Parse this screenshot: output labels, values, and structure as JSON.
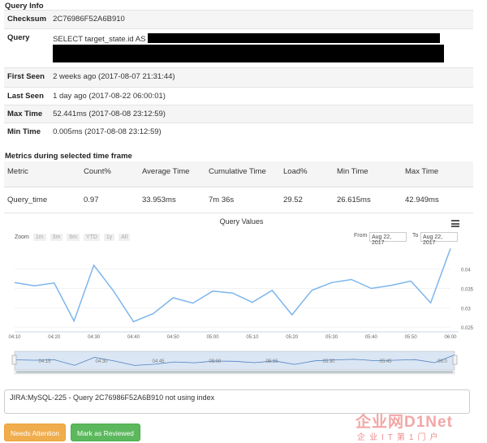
{
  "query_info": {
    "title": "Query Info",
    "checksum_label": "Checksum",
    "checksum": "2C76986F52A6B910",
    "query_label": "Query",
    "query_text": "SELECT target_state.id AS",
    "first_seen_label": "First Seen",
    "first_seen": "2 weeks ago (2017-08-07 21:31:44)",
    "last_seen_label": "Last Seen",
    "last_seen": "1 day ago (2017-08-22 06:00:01)",
    "max_time_label": "Max Time",
    "max_time": "52.441ms (2017-08-08 23:12:59)",
    "min_time_label": "Min Time",
    "min_time": "0.005ms (2017-08-08 23:12:59)"
  },
  "metrics": {
    "title": "Metrics during selected time frame",
    "headers": [
      "Metric",
      "Count%",
      "Average Time",
      "Cumulative Time",
      "Load%",
      "Min Time",
      "Max Time"
    ],
    "rows": [
      [
        "Query_time",
        "0.97",
        "33.953ms",
        "7m 36s",
        "29.52",
        "26.615ms",
        "42.949ms"
      ]
    ]
  },
  "chart": {
    "title": "Query Values",
    "zoom_label": "Zoom",
    "zoom_buttons": [
      "1m",
      "3m",
      "6m",
      "YTD",
      "1y",
      "All"
    ],
    "from_label": "From",
    "from_value": "Aug 22, 2017",
    "to_label": "To",
    "to_value": "Aug 22, 2017",
    "navigator_labels": [
      "04:15",
      "04:30",
      "04:45",
      "05:00",
      "05:15",
      "05:30",
      "05:45",
      "06:0"
    ]
  },
  "chart_data": {
    "type": "line",
    "title": "Query Values",
    "x": [
      "04:10",
      "04:15",
      "04:20",
      "04:25",
      "04:30",
      "04:35",
      "04:40",
      "04:45",
      "04:50",
      "04:55",
      "05:00",
      "05:05",
      "05:10",
      "05:15",
      "05:20",
      "05:25",
      "05:30",
      "05:35",
      "05:40",
      "05:45",
      "05:50",
      "05:55",
      "06:00"
    ],
    "x_ticks": [
      "04:10",
      "04:20",
      "04:30",
      "04:40",
      "04:50",
      "05:00",
      "05:10",
      "05:20",
      "05:30",
      "05:40",
      "05:50",
      "06:00"
    ],
    "series": [
      {
        "values": [
          0.0365,
          0.0357,
          0.0364,
          0.0266,
          0.041,
          0.0343,
          0.0264,
          0.0285,
          0.0326,
          0.0312,
          0.0343,
          0.0338,
          0.0314,
          0.0345,
          0.0282,
          0.0345,
          0.0365,
          0.0373,
          0.035,
          0.0358,
          0.0369,
          0.0313,
          0.0453
        ]
      }
    ],
    "y_ticks": [
      "0.025",
      "0.03",
      "0.035",
      "0.04"
    ],
    "ylim": [
      0.024,
      0.046
    ],
    "color": "#7cb5ec"
  },
  "jira_text": "JIRA:MySQL-225 - Query 2C76986F52A6B910 not using index",
  "buttons": {
    "needs_attention": "Needs Attention",
    "mark_reviewed": "Mark as Reviewed"
  },
  "watermark": {
    "big": "企业网D1Net",
    "small": "企业IT第1门户"
  }
}
